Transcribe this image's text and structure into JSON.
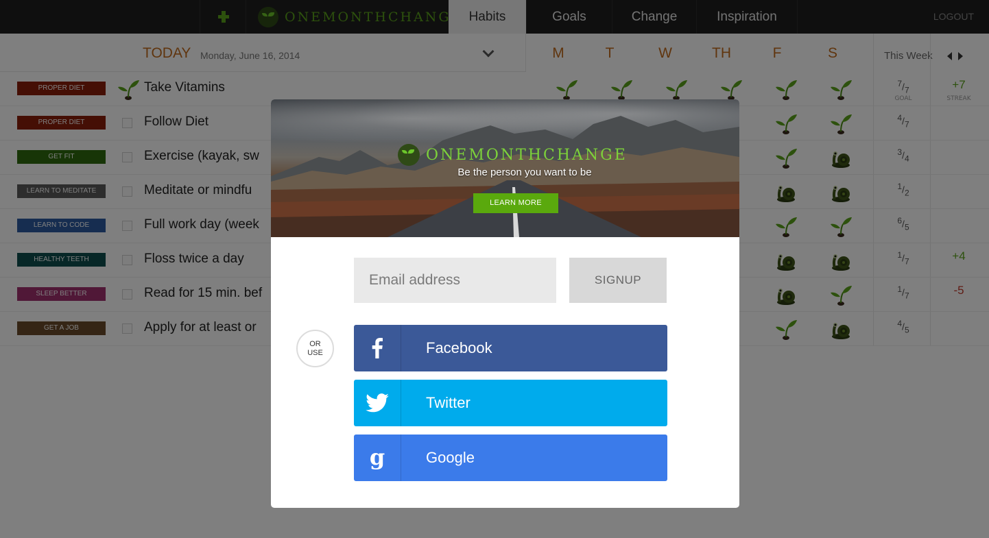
{
  "nav": {
    "brand": "ONEMONTHCHANGE",
    "tabs": [
      {
        "label": "Habits",
        "active": true
      },
      {
        "label": "Goals",
        "active": false
      },
      {
        "label": "Change",
        "active": false
      },
      {
        "label": "Inspiration",
        "active": false
      }
    ],
    "logout": "LOGOUT"
  },
  "dashboard": {
    "today_label": "TODAY",
    "date": "Monday, June 16, 2014",
    "days": [
      "M",
      "T",
      "W",
      "TH",
      "F",
      "S"
    ],
    "week_label": "This Week",
    "goal_caption": "GOAL",
    "streak_caption": "STREAK",
    "habits": [
      {
        "tag": "PROPER DIET",
        "tag_color": "#8b1f0a",
        "name": "Take Vitamins",
        "done": true,
        "done_count": "7",
        "goal_count": "7",
        "streak": "+7",
        "streak_color": "#5aa31b"
      },
      {
        "tag": "PROPER DIET",
        "tag_color": "#8b1f0a",
        "name": "Follow Diet",
        "done": false,
        "done_count": "4",
        "goal_count": "7",
        "streak": "",
        "streak_color": "#5aa31b"
      },
      {
        "tag": "GET FIT",
        "tag_color": "#2e6b0f",
        "name": "Exercise (kayak, sw",
        "done": false,
        "done_count": "3",
        "goal_count": "4",
        "streak": "",
        "streak_color": "#5aa31b"
      },
      {
        "tag": "LEARN TO MEDITATE",
        "tag_color": "#5a5a5a",
        "name": "Meditate or mindfu",
        "done": false,
        "done_count": "1",
        "goal_count": "2",
        "streak": "",
        "streak_color": "#5aa31b"
      },
      {
        "tag": "LEARN TO CODE",
        "tag_color": "#2c5aa0",
        "name": "Full work day (week",
        "done": false,
        "done_count": "6",
        "goal_count": "5",
        "streak": "",
        "streak_color": "#5aa31b"
      },
      {
        "tag": "HEALTHY TEETH",
        "tag_color": "#0f4f4f",
        "name": "Floss twice a day",
        "done": false,
        "done_count": "1",
        "goal_count": "7",
        "streak": "+4",
        "streak_color": "#5aa31b"
      },
      {
        "tag": "SLEEP BETTER",
        "tag_color": "#a0306e",
        "name": "Read for 15 min. bef",
        "done": false,
        "done_count": "1",
        "goal_count": "7",
        "streak": "-5",
        "streak_color": "#c0392b"
      },
      {
        "tag": "GET A JOB",
        "tag_color": "#6b4a2a",
        "name": "Apply for at least or",
        "done": false,
        "done_count": "4",
        "goal_count": "5",
        "streak": "",
        "streak_color": "#5aa31b"
      }
    ],
    "week_icons": [
      [
        "sprout",
        "sprout",
        "sprout",
        "sprout",
        "sprout",
        "sprout"
      ],
      [
        "",
        "",
        "",
        "",
        "sprout",
        "sprout"
      ],
      [
        "",
        "",
        "",
        "",
        "sprout",
        "snail"
      ],
      [
        "",
        "",
        "",
        "",
        "snail",
        "snail"
      ],
      [
        "",
        "",
        "",
        "",
        "sprout",
        "sprout"
      ],
      [
        "",
        "",
        "",
        "",
        "snail",
        "snail"
      ],
      [
        "",
        "",
        "",
        "",
        "snail",
        "sprout"
      ],
      [
        "",
        "",
        "",
        "",
        "sprout",
        "snail"
      ]
    ]
  },
  "modal": {
    "brand": "ONEMONTHCHANGE",
    "tagline": "Be the person you want to be",
    "learn_more": "LEARN MORE",
    "email_placeholder": "Email address",
    "signup": "SIGNUP",
    "or_line1": "OR",
    "or_line2": "USE",
    "social": [
      {
        "label": "Facebook",
        "icon": "facebook-icon",
        "color": "#3b5998"
      },
      {
        "label": "Twitter",
        "icon": "twitter-icon",
        "color": "#00abec"
      },
      {
        "label": "Google",
        "icon": "google-icon",
        "color": "#3b7bea"
      }
    ]
  }
}
